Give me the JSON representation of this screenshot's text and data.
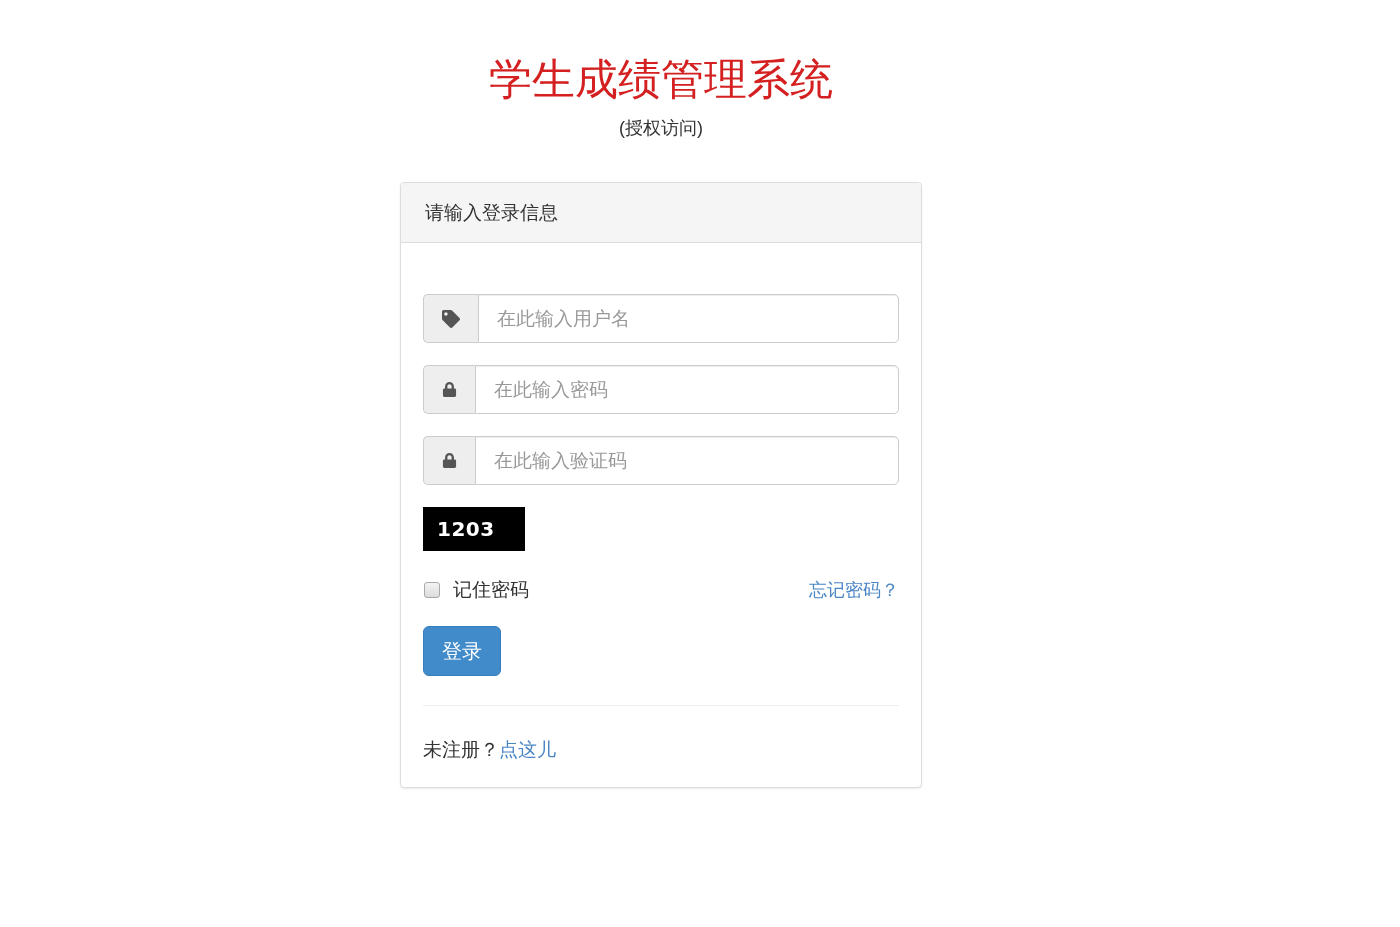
{
  "title": "学生成绩管理系统",
  "subtitle": "(授权访问)",
  "login_panel": {
    "heading": "请输入登录信息",
    "fields": [
      {
        "kind": "username",
        "placeholder": "在此输入用户名"
      },
      {
        "kind": "password",
        "placeholder": "在此输入密码"
      },
      {
        "kind": "captcha",
        "placeholder": "在此输入验证码"
      }
    ],
    "captcha_code": "1203",
    "remember": {
      "label": "记住密码",
      "checked": false
    },
    "forgot_link": "忘记密码？",
    "login_button": "登录",
    "register": {
      "prompt": "未注册？",
      "link": "点这儿"
    }
  }
}
